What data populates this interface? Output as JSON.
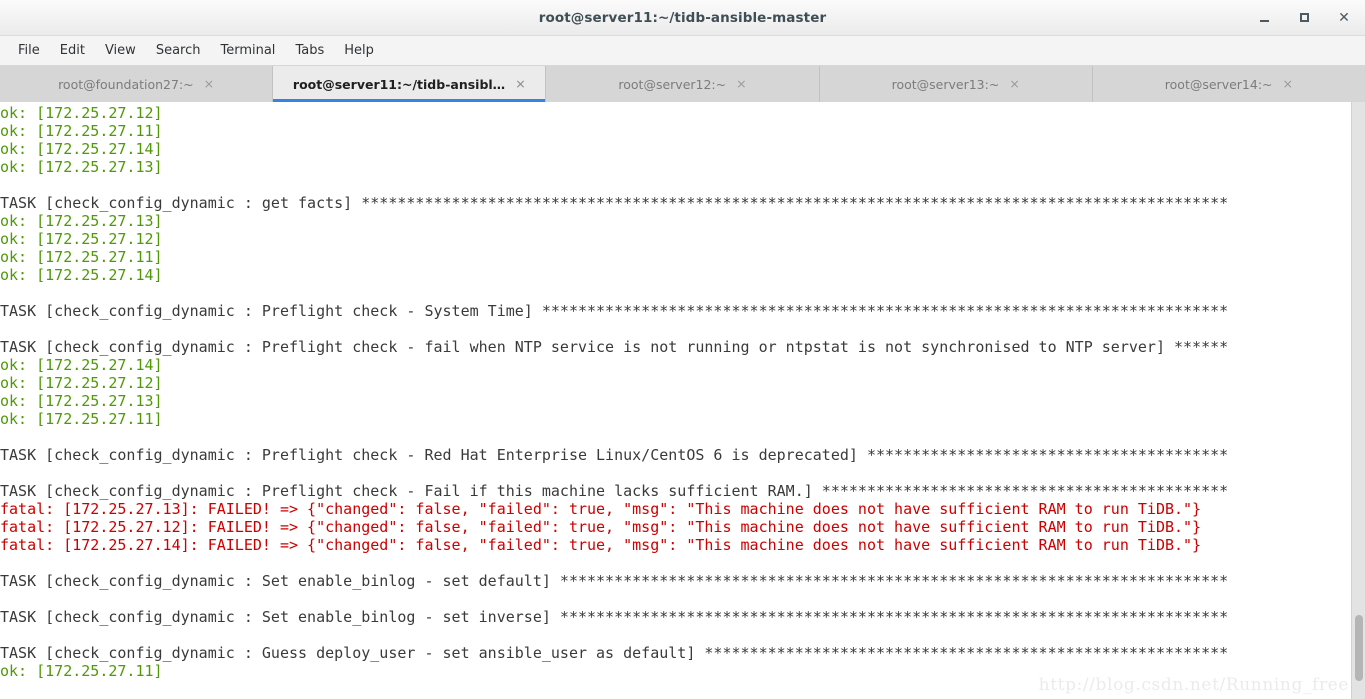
{
  "window": {
    "title": "root@server11:~/tidb-ansible-master",
    "controls": {
      "minimize": "–",
      "maximize": "□",
      "close": "×"
    }
  },
  "menubar": {
    "items": [
      {
        "label": "File"
      },
      {
        "label": "Edit"
      },
      {
        "label": "View"
      },
      {
        "label": "Search"
      },
      {
        "label": "Terminal"
      },
      {
        "label": "Tabs"
      },
      {
        "label": "Help"
      }
    ]
  },
  "tabs": [
    {
      "label": "root@foundation27:~",
      "close": "×",
      "active": false
    },
    {
      "label": "root@server11:~/tidb-ansibl…",
      "close": "×",
      "active": true
    },
    {
      "label": "root@server12:~",
      "close": "×",
      "active": false
    },
    {
      "label": "root@server13:~",
      "close": "×",
      "active": false
    },
    {
      "label": "root@server14:~",
      "close": "×",
      "active": false
    }
  ],
  "colors": {
    "ok_green": "#4e9a06",
    "fatal_red": "#cc0000",
    "normal_text": "#3a3a3a",
    "tab_accent": "#3584e4",
    "terminal_bg": "#ffffff"
  },
  "terminal": {
    "lines": [
      {
        "color": "green",
        "text": "ok: [172.25.27.12]"
      },
      {
        "color": "green",
        "text": "ok: [172.25.27.11]"
      },
      {
        "color": "green",
        "text": "ok: [172.25.27.14]"
      },
      {
        "color": "green",
        "text": "ok: [172.25.27.13]"
      },
      {
        "color": "normal",
        "text": ""
      },
      {
        "color": "normal",
        "text": "TASK [check_config_dynamic : get facts] ************************************************************************************************"
      },
      {
        "color": "green",
        "text": "ok: [172.25.27.13]"
      },
      {
        "color": "green",
        "text": "ok: [172.25.27.12]"
      },
      {
        "color": "green",
        "text": "ok: [172.25.27.11]"
      },
      {
        "color": "green",
        "text": "ok: [172.25.27.14]"
      },
      {
        "color": "normal",
        "text": ""
      },
      {
        "color": "normal",
        "text": "TASK [check_config_dynamic : Preflight check - System Time] ****************************************************************************"
      },
      {
        "color": "normal",
        "text": ""
      },
      {
        "color": "normal",
        "text": "TASK [check_config_dynamic : Preflight check - fail when NTP service is not running or ntpstat is not synchronised to NTP server] ******"
      },
      {
        "color": "green",
        "text": "ok: [172.25.27.14]"
      },
      {
        "color": "green",
        "text": "ok: [172.25.27.12]"
      },
      {
        "color": "green",
        "text": "ok: [172.25.27.13]"
      },
      {
        "color": "green",
        "text": "ok: [172.25.27.11]"
      },
      {
        "color": "normal",
        "text": ""
      },
      {
        "color": "normal",
        "text": "TASK [check_config_dynamic : Preflight check - Red Hat Enterprise Linux/CentOS 6 is deprecated] ****************************************"
      },
      {
        "color": "normal",
        "text": ""
      },
      {
        "color": "normal",
        "text": "TASK [check_config_dynamic : Preflight check - Fail if this machine lacks sufficient RAM.] *********************************************"
      },
      {
        "color": "red",
        "text": "fatal: [172.25.27.13]: FAILED! => {\"changed\": false, \"failed\": true, \"msg\": \"This machine does not have sufficient RAM to run TiDB.\"}"
      },
      {
        "color": "red",
        "text": "fatal: [172.25.27.12]: FAILED! => {\"changed\": false, \"failed\": true, \"msg\": \"This machine does not have sufficient RAM to run TiDB.\"}"
      },
      {
        "color": "red",
        "text": "fatal: [172.25.27.14]: FAILED! => {\"changed\": false, \"failed\": true, \"msg\": \"This machine does not have sufficient RAM to run TiDB.\"}"
      },
      {
        "color": "normal",
        "text": ""
      },
      {
        "color": "normal",
        "text": "TASK [check_config_dynamic : Set enable_binlog - set default] **************************************************************************"
      },
      {
        "color": "normal",
        "text": ""
      },
      {
        "color": "normal",
        "text": "TASK [check_config_dynamic : Set enable_binlog - set inverse] **************************************************************************"
      },
      {
        "color": "normal",
        "text": ""
      },
      {
        "color": "normal",
        "text": "TASK [check_config_dynamic : Guess deploy_user - set ansible_user as default] **********************************************************"
      },
      {
        "color": "green",
        "text": "ok: [172.25.27.11]"
      }
    ],
    "scrollbar": {
      "thumb_top_pct": 86,
      "thumb_height_pct": 11
    }
  },
  "watermark": {
    "text": "http://blog.csdn.net/Running_free"
  }
}
